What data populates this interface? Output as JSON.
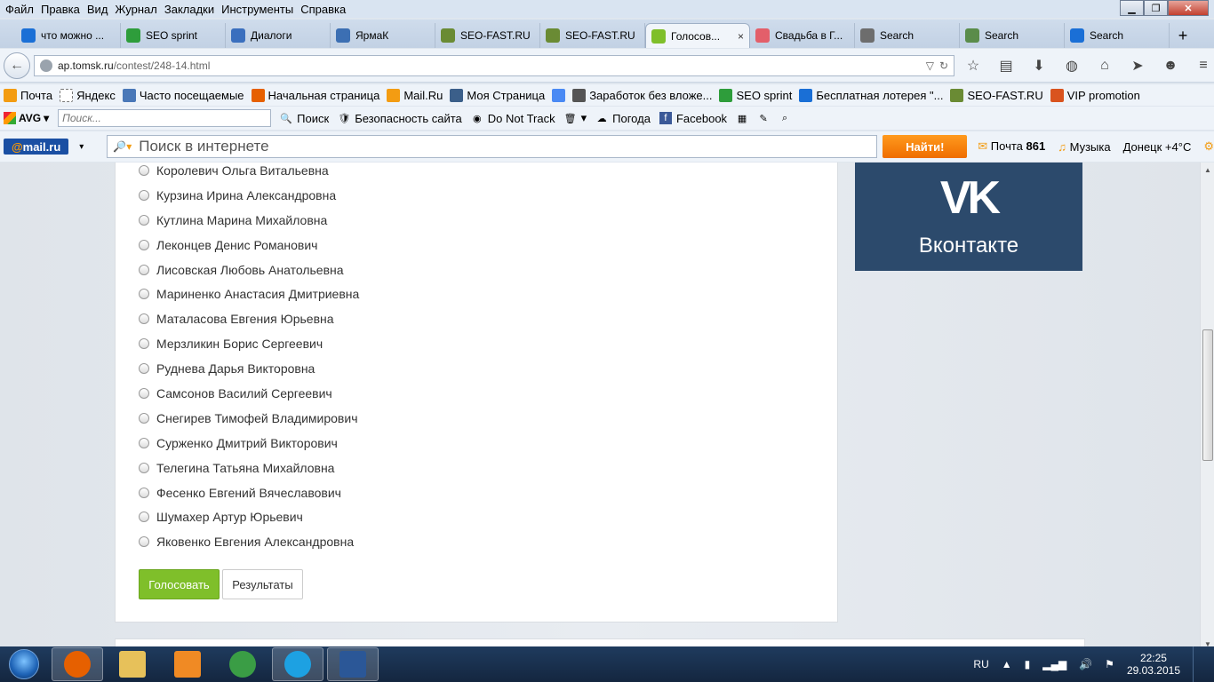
{
  "menu": [
    "Файл",
    "Правка",
    "Вид",
    "Журнал",
    "Закладки",
    "Инструменты",
    "Справка"
  ],
  "tabs": [
    {
      "title": "что можно ...",
      "icon": "search-icon",
      "color": "#1a6fd6",
      "active": false
    },
    {
      "title": "SEO sprint",
      "icon": "seo-sprint-icon",
      "color": "#2e9d3b",
      "active": false
    },
    {
      "title": "Диалоги",
      "icon": "dialogs-icon",
      "color": "#3a6fbe",
      "active": false
    },
    {
      "title": "ЯрмаК",
      "icon": "video-icon",
      "color": "#3c6fb3",
      "active": false
    },
    {
      "title": "SEO-FAST.RU",
      "icon": "seo-fast-icon",
      "color": "#6a8b34",
      "active": false
    },
    {
      "title": "SEO-FAST.RU",
      "icon": "seo-fast-icon",
      "color": "#6a8b34",
      "active": false
    },
    {
      "title": "Голосов...",
      "icon": "vote-icon",
      "color": "#7fbf2a",
      "active": true
    },
    {
      "title": "Свадьба в Г...",
      "icon": "wedding-icon",
      "color": "#e35f6a",
      "active": false
    },
    {
      "title": "Search",
      "icon": "google-search-icon",
      "color": "#6d6d6d",
      "active": false
    },
    {
      "title": "Search",
      "icon": "image-search-icon",
      "color": "#5a8c4a",
      "active": false
    },
    {
      "title": "Search",
      "icon": "search-icon",
      "color": "#1a6fd6",
      "active": false
    }
  ],
  "active_tab_close": "×",
  "new_tab": "+",
  "nav": {
    "url_host": "ap.tomsk.ru",
    "url_path": "/contest/248-14.html"
  },
  "bookmarks": [
    {
      "label": "Почта",
      "icon": "mail-icon",
      "color": "#f39c12"
    },
    {
      "label": "Яндекс",
      "icon": "page-icon",
      "color": "#ffffff"
    },
    {
      "label": "Часто посещаемые",
      "icon": "frequent-icon",
      "color": "#4a78b8"
    },
    {
      "label": "Начальная страница",
      "icon": "firefox-icon",
      "color": "#e66000"
    },
    {
      "label": "Mail.Ru",
      "icon": "mailru-icon",
      "color": "#f39c12"
    },
    {
      "label": "Моя Страница",
      "icon": "vk-icon",
      "color": "#3b5f8a"
    },
    {
      "label": "",
      "icon": "google-icon",
      "color": "#4a8af4"
    },
    {
      "label": "Заработок без вложе...",
      "icon": "google-chrome-icon",
      "color": "#555555"
    },
    {
      "label": "SEO sprint",
      "icon": "seo-sprint-icon",
      "color": "#2e9d3b"
    },
    {
      "label": "Бесплатная лотерея \"...",
      "icon": "lottery-icon",
      "color": "#1a6fd6"
    },
    {
      "label": "SEO-FAST.RU",
      "icon": "seo-fast-icon",
      "color": "#6a8b34"
    },
    {
      "label": "VIP promotion",
      "icon": "vip-icon",
      "color": "#d9531e"
    }
  ],
  "avg": {
    "logo": "AVG",
    "search_placeholder": "Поиск...",
    "search_label": "Поиск",
    "items": [
      "Безопасность сайта",
      "Do Not Track",
      "Погода",
      "Facebook"
    ]
  },
  "mailru": {
    "search_placeholder": "Поиск в интернете",
    "find_label": "Найти!",
    "mail_label": "Почта",
    "mail_count": "861",
    "music_label": "Музыка",
    "weather": "Донецк +4°C"
  },
  "poll": {
    "options": [
      "Королевич Ольга Витальевна",
      "Курзина Ирина Александровна",
      "Кутлина Марина Михайловна",
      "Леконцев Денис Романович",
      "Лисовская Любовь Анатольевна",
      "Мариненко Анастасия Дмитриевна",
      "Маталасова Евгения Юрьевна",
      "Мерзликин Борис Сергеевич",
      "Руднева Дарья Викторовна",
      "Самсонов Василий Сергеевич",
      "Снегирев Тимофей Владимирович",
      "Сурженко Дмитрий Викторович",
      "Телегина Татьяна Михайловна",
      "Фесенко Евгений Вячеславович",
      "Шумахер Артур Юрьевич",
      "Яковенко Евгения Александровна"
    ],
    "vote_label": "Голосовать",
    "results_label": "Результаты"
  },
  "vk_banner": {
    "logo": "VK",
    "name": "Вконтакте"
  },
  "taskbar": {
    "apps": [
      {
        "name": "firefox",
        "color": "#e66000",
        "active": true
      },
      {
        "name": "explorer",
        "color": "#e7c15a",
        "active": false
      },
      {
        "name": "media-player",
        "color": "#f08a24",
        "active": false
      },
      {
        "name": "chrome",
        "color": "#3a9d45",
        "active": false
      },
      {
        "name": "skype",
        "color": "#1da1e2",
        "active": true
      },
      {
        "name": "word",
        "color": "#2b5797",
        "active": true
      }
    ],
    "lang": "RU",
    "time": "22:25",
    "date": "29.03.2015"
  }
}
